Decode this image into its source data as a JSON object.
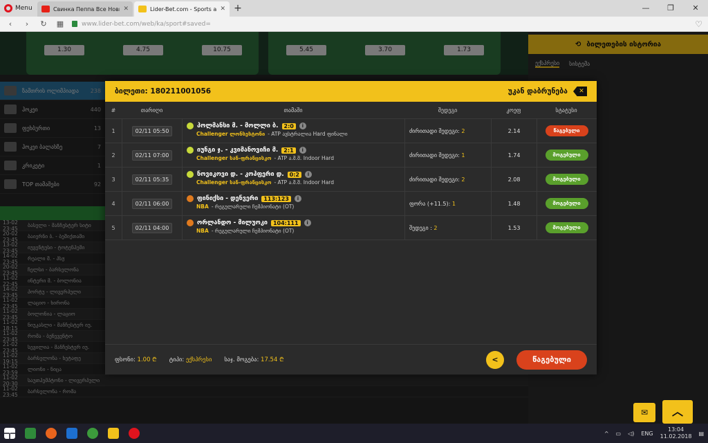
{
  "browser": {
    "menu_label": "Menu",
    "tabs": [
      {
        "title": "Свинка Пеппа Все Новые",
        "favicon_color": "#e62117",
        "active": false
      },
      {
        "title": "Lider-Bet.com - Sports and",
        "favicon_color": "#f2c11b",
        "active": true
      }
    ],
    "new_tab": "+",
    "url": "www.lider-bet.com/web/ka/sport#saved="
  },
  "background": {
    "banner_odds_left": [
      "1.30",
      "4.75",
      "10.75"
    ],
    "banner_odds_right": [
      "5.45",
      "3.70",
      "1.73"
    ],
    "history_button": "ბილეთების ისტორია",
    "right_tabs": [
      "ექსპრესი",
      "სისტემა"
    ],
    "sidebar": [
      {
        "label": "ზამთრის ოლიმპიადა",
        "count": "238",
        "active": true
      },
      {
        "label": "ჰოკეი",
        "count": "440",
        "active": false
      },
      {
        "label": "ფეხბურთი",
        "count": "13",
        "active": false
      },
      {
        "label": "ჰოკეი ბალახზე",
        "count": "7",
        "active": false
      },
      {
        "label": "კრიკეტი",
        "count": "1",
        "active": false
      },
      {
        "label": "TOP თამაშები",
        "count": "92",
        "active": false
      }
    ],
    "rows": [
      {
        "time": "13-02 23:45",
        "match": "ბასელი - მანჩესტერ სიტი"
      },
      {
        "time": "20-02 23:45",
        "match": "ბაიერნი ბ. - ბეშიქთაში"
      },
      {
        "time": "13-02 23:45",
        "match": "იუვენტუსი - ტოტენჰემი"
      },
      {
        "time": "14-02 23:45",
        "match": "რეალი მ. - პსჟ"
      },
      {
        "time": "20-02 23:45",
        "match": "ჩელსი - ბარსელონა"
      },
      {
        "time": "11-02 22:45",
        "match": "ინტერი მ. - ბოლონია"
      },
      {
        "time": "14-02 23:45",
        "match": "პორტუ - ლივერპული"
      },
      {
        "time": "11-02 23:45",
        "match": "ლაციო - ხირონა"
      },
      {
        "time": "11-02 23:45",
        "match": "ბოლონია - ლაციო"
      },
      {
        "time": "11-02 18:15",
        "match": "ნიუკასლი - მანჩესტერ იუ."
      },
      {
        "time": "11-02 23:45",
        "match": "რომა - ბენევენტო"
      },
      {
        "time": "21-02 23:45",
        "match": "სევილია - მანჩესტერ იუ."
      },
      {
        "time": "11-02 19:15",
        "match": "ბარსელონა - ხეტაფე"
      },
      {
        "time": "11-02 23:59",
        "match": "ლიონი - ნიცა"
      },
      {
        "time": "11-02 20:30",
        "match": "საუთჰემპტონი - ლივერპული"
      },
      {
        "time": "11-02 23:45",
        "match": "ბარსელონა - რომა"
      }
    ]
  },
  "modal": {
    "ticket_label": "ბილეთი:",
    "ticket_number": "180211001056",
    "back_label": "უკან დაბრუნება",
    "columns": [
      "#",
      "თარიღი",
      "თამაში",
      "შედეგი",
      "კოეფ",
      "სტატუსი"
    ],
    "rows": [
      {
        "num": "1",
        "date": "02/11 05:50",
        "sport": "tennis",
        "teams": "პოლმანსი მ. - მოლლი ბ.",
        "score": "2:0",
        "league": "Challenger ლონსესტონი",
        "league_rest": "- ATP ავსტრალია Hard ფინალი",
        "pick_label": "ძირითადი შედეგი:",
        "pick_value": "2",
        "odd": "2.14",
        "status": "წაგებული",
        "status_type": "lost"
      },
      {
        "num": "2",
        "date": "02/11 07:00",
        "sport": "tennis",
        "teams": "იუნგი ჯ. - კვიმანოვიჩი მ.",
        "score": "2:1",
        "league": "Challenger სან-ფრანცისკო",
        "league_rest": "- ATP ა.შ.შ. Indoor Hard",
        "pick_label": "ძირითადი შედეგი:",
        "pick_value": "1",
        "odd": "1.74",
        "status": "მოგებული",
        "status_type": "won"
      },
      {
        "num": "3",
        "date": "02/11 05:35",
        "sport": "tennis",
        "teams": "ნოვიკოვი დ. - კოპფერი დ.",
        "score": "0:2",
        "league": "Challenger სან-ფრანცისკო",
        "league_rest": "- ATP ა.შ.შ. Indoor Hard",
        "pick_label": "ძირითადი შედეგი:",
        "pick_value": "2",
        "odd": "2.08",
        "status": "მოგებული",
        "status_type": "won"
      },
      {
        "num": "4",
        "date": "02/11 06:00",
        "sport": "basket",
        "teams": "ფინიქსი - დენვერი",
        "score": "113:123",
        "league": "NBA",
        "league_rest": "- რეგულარული ჩემპიონატი (OT)",
        "pick_label": "ფორა (+11.5):",
        "pick_value": "1",
        "odd": "1.48",
        "status": "მოგებული",
        "status_type": "won"
      },
      {
        "num": "5",
        "date": "02/11 04:00",
        "sport": "basket",
        "teams": "ორლანდო - მილუოკი",
        "score": "104:111",
        "league": "NBA",
        "league_rest": "- რეგულარული ჩემპიონატი (OT)",
        "pick_label": "შედეგი :",
        "pick_value": "2",
        "odd": "1.53",
        "status": "მოგებული",
        "status_type": "won"
      }
    ],
    "footer": {
      "stake_label": "ფსონი:",
      "stake_value": "1.00 ₾",
      "type_label": "ტიპი:",
      "type_value": "ექსპრესი",
      "win_label": "საჯ. მოგება:",
      "win_value": "17.54 ₾",
      "share_icon": "share-icon",
      "result_button": "წაგებული"
    }
  },
  "taskbar": {
    "lang": "ENG",
    "time": "13:04",
    "date": "11.02.2018"
  },
  "colors": {
    "accent": "#f2c11b",
    "lost": "#d9421c",
    "won": "#5aa02c"
  }
}
